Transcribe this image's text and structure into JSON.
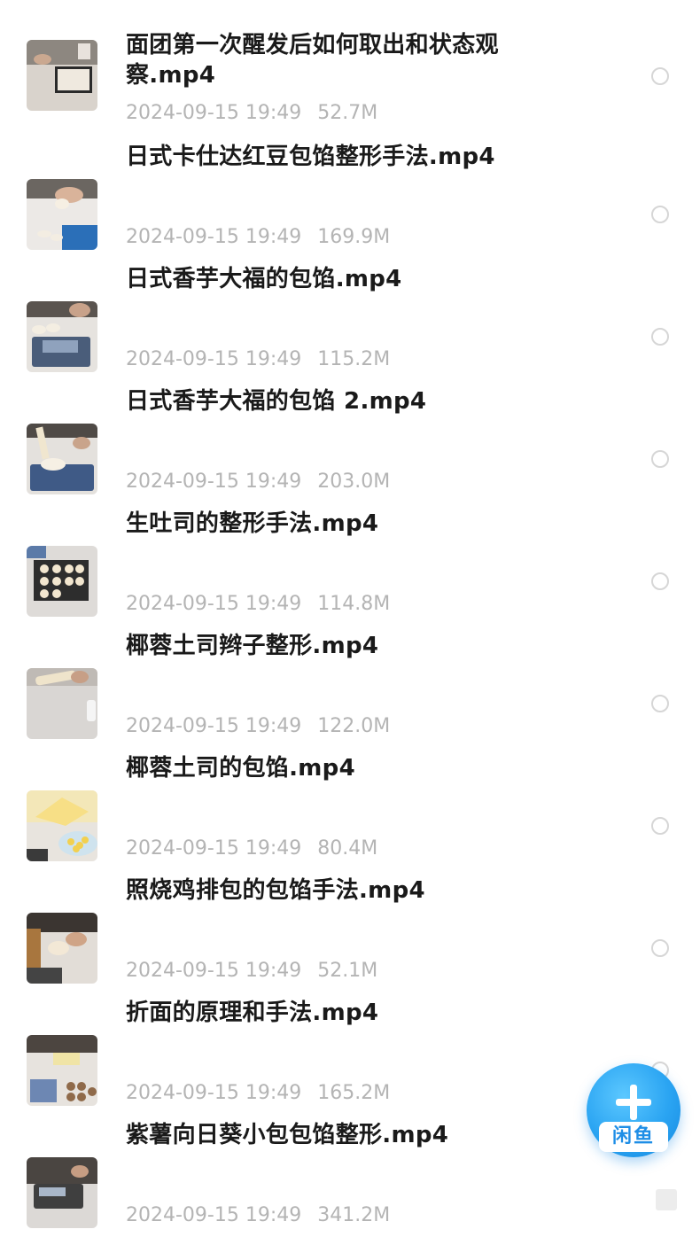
{
  "files": [
    {
      "name": "面团第一次醒发后如何取出和状态观察.mp4",
      "date": "2024-09-15 19:49",
      "size": "52.7M",
      "thumb": "dough-tray"
    },
    {
      "name": "日式卡仕达红豆包馅整形手法.mp4",
      "date": "2024-09-15 19:49",
      "size": "169.9M",
      "thumb": "bun-filling"
    },
    {
      "name": "日式香芋大福的包馅.mp4",
      "date": "2024-09-15 19:49",
      "size": "115.2M",
      "thumb": "scale-buns"
    },
    {
      "name": "日式香芋大福的包馅 2.mp4",
      "date": "2024-09-15 19:49",
      "size": "203.0M",
      "thumb": "scale-piping"
    },
    {
      "name": "生吐司的整形手法.mp4",
      "date": "2024-09-15 19:49",
      "size": "114.8M",
      "thumb": "tray-buns"
    },
    {
      "name": "椰蓉土司辫子整形.mp4",
      "date": "2024-09-15 19:49",
      "size": "122.0M",
      "thumb": "braid"
    },
    {
      "name": "椰蓉土司的包馅.mp4",
      "date": "2024-09-15 19:49",
      "size": "80.4M",
      "thumb": "coconut-filling"
    },
    {
      "name": "照烧鸡排包的包馅手法.mp4",
      "date": "2024-09-15 19:49",
      "size": "52.1M",
      "thumb": "chicken-bun"
    },
    {
      "name": "折面的原理和手法.mp4",
      "date": "2024-09-15 19:49",
      "size": "165.2M",
      "thumb": "folding"
    },
    {
      "name": "紫薯向日葵小包包馅整形.mp4",
      "date": "2024-09-15 19:49",
      "size": "341.2M",
      "thumb": "purple-potato"
    }
  ],
  "fab": {
    "badge": "闲鱼"
  },
  "colors": {
    "accent": "#2aa4f2",
    "meta_text": "#b4b4b4",
    "title_text": "#1a1a1a"
  }
}
